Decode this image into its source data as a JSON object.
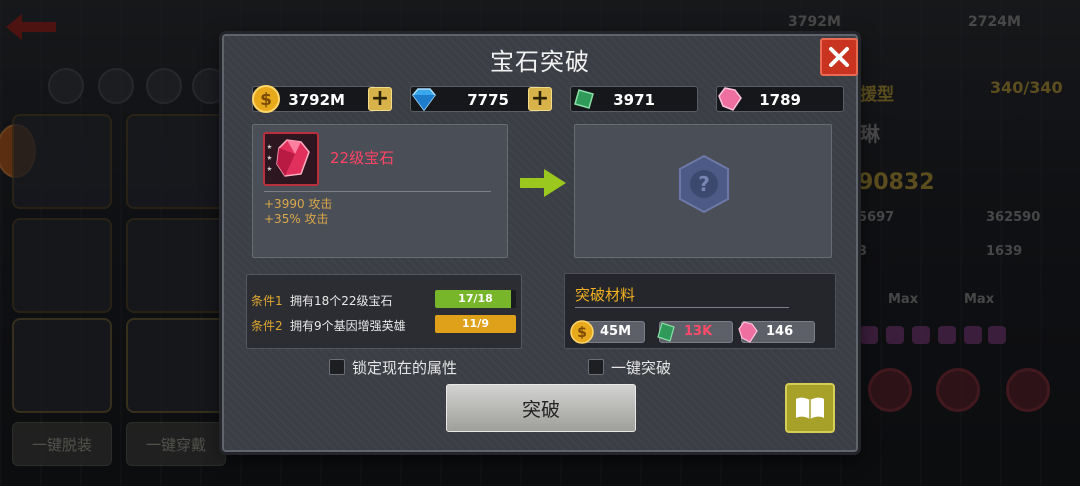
{
  "background": {
    "top_currency_gold": "3792M",
    "top_currency_green": "2724M",
    "hero_type_fragment": "援型",
    "hero_hp": "340/340",
    "hero_name_fragment": "琳",
    "hero_power_fragment": "90832",
    "stat_a": "5697",
    "stat_b": "362590",
    "stat_c": "3",
    "stat_d": "1639",
    "max_label_1": "Max",
    "max_label_2": "Max",
    "slot_badge": "3",
    "btn_unequip_all": "一键脱装",
    "btn_equip_all": "一键穿戴"
  },
  "dialog": {
    "title": "宝石突破",
    "resources": {
      "gold": "3792M",
      "diamond": "7775",
      "green_gem": "3971",
      "pink_crystal": "1789"
    },
    "gem": {
      "name": "22级宝石",
      "stats": [
        "+3990 攻击",
        "+35% 攻击"
      ],
      "stars": 3
    },
    "conditions": [
      {
        "label": "条件1",
        "text": "拥有18个22级宝石",
        "progress": "17/18",
        "ratio": 0.944,
        "color": "#77b52a"
      },
      {
        "label": "条件2",
        "text": "拥有9个基因增强英雄",
        "progress": "11/9",
        "ratio": 1.0,
        "color": "#e0a11a"
      }
    ],
    "materials": {
      "title": "突破材料",
      "items": [
        {
          "name": "gold",
          "value": "45M",
          "color": "#ffffff"
        },
        {
          "name": "green_gem",
          "value": "13K",
          "color": "#ff4a6a"
        },
        {
          "name": "pink_crystal",
          "value": "146",
          "color": "#ffffff"
        }
      ]
    },
    "lock_label": "锁定现在的属性",
    "oneclick_label": "一键突破",
    "break_button": "突破"
  }
}
